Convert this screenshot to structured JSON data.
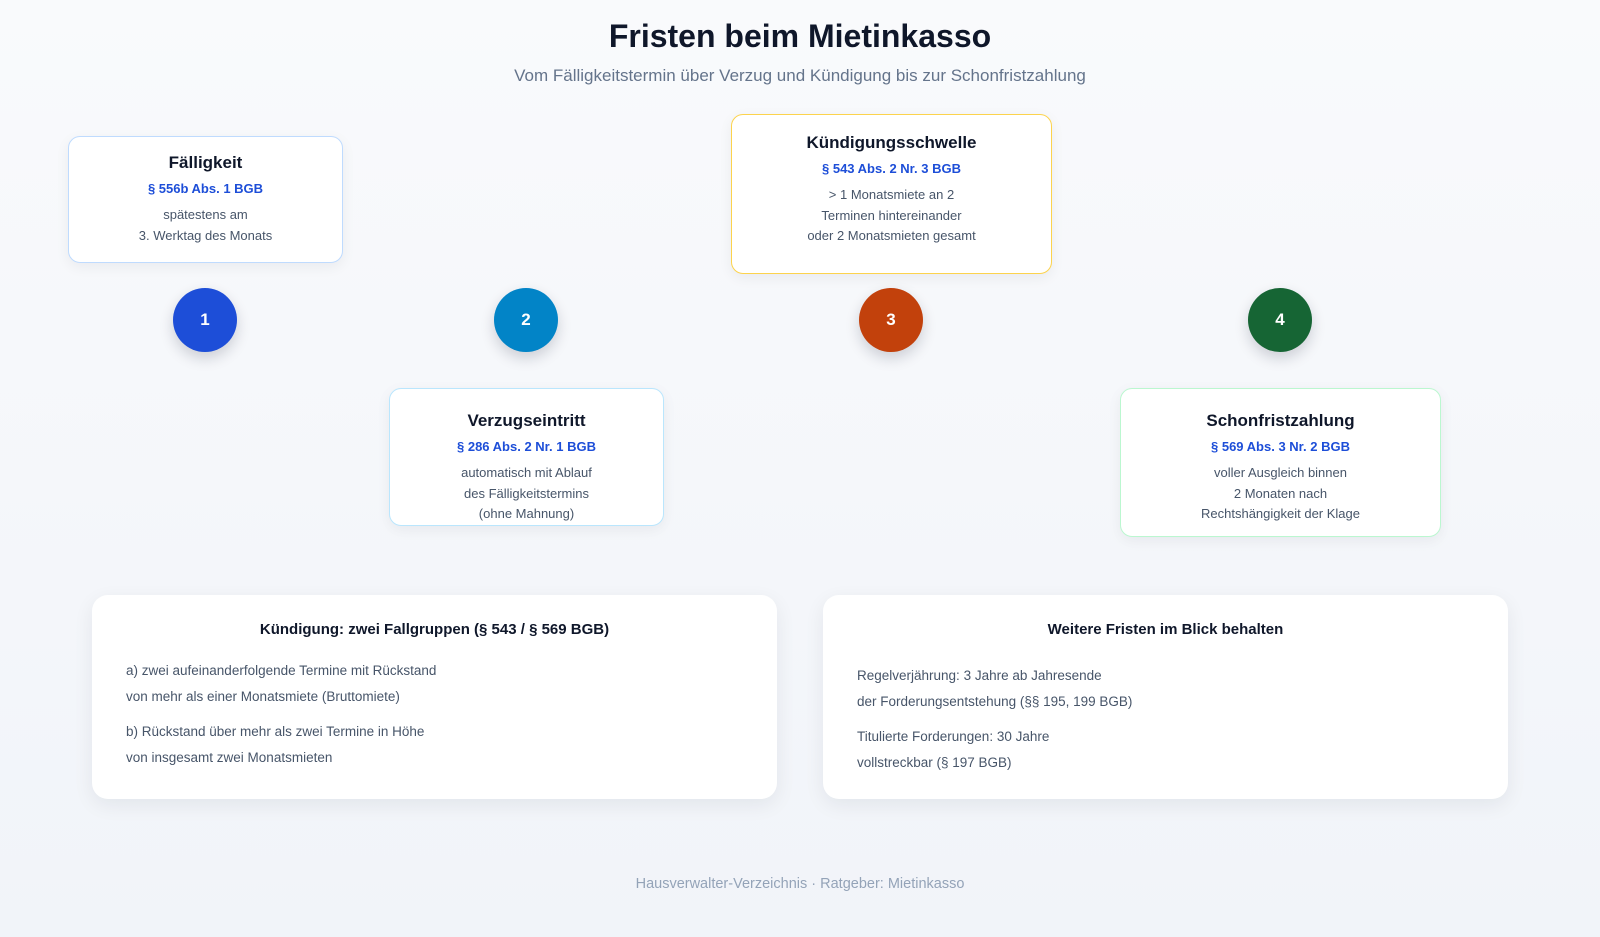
{
  "header": {
    "title": "Fristen beim Mietinkasso",
    "subtitle": "Vom Fälligkeitstermin über Verzug und Kündigung bis zur Schonfristzahlung"
  },
  "steps": [
    {
      "number": "1",
      "title": "Fälligkeit",
      "law": "§ 556b Abs. 1 BGB",
      "lines": [
        "spätestens am",
        "3. Werktag des Monats"
      ],
      "color": "#1d4ed8"
    },
    {
      "number": "2",
      "title": "Verzugseintritt",
      "law": "§ 286 Abs. 2 Nr. 1 BGB",
      "lines": [
        "automatisch mit Ablauf",
        "des Fälligkeitstermins",
        "(ohne Mahnung)"
      ],
      "color": "#0284c7"
    },
    {
      "number": "3",
      "title": "Kündigungsschwelle",
      "law": "§ 543 Abs. 2 Nr. 3 BGB",
      "lines": [
        "> 1 Monatsmiete an 2",
        "Terminen hintereinander",
        "oder 2 Monatsmieten gesamt"
      ],
      "color": "#c2410c"
    },
    {
      "number": "4",
      "title": "Schonfristzahlung",
      "law": "§ 569 Abs. 3 Nr. 2 BGB",
      "lines": [
        "voller Ausgleich binnen",
        "2 Monaten nach",
        "Rechtshängigkeit der Klage"
      ],
      "color": "#166534"
    }
  ],
  "info_boxes": [
    {
      "title": "Kündigung: zwei Fallgruppen (§ 543 / § 569 BGB)",
      "items": [
        [
          "a) zwei aufeinanderfolgende Termine mit Rückstand",
          "von mehr als einer Monatsmiete (Bruttomiete)"
        ],
        [
          "b) Rückstand über mehr als zwei Termine in Höhe",
          "von insgesamt zwei Monatsmieten"
        ]
      ]
    },
    {
      "title": "Weitere Fristen im Blick behalten",
      "items": [
        [
          "Regelverjährung: 3 Jahre ab Jahresende",
          "der Forderungsentstehung (§§ 195, 199 BGB)"
        ],
        [
          "Titulierte Forderungen: 30 Jahre",
          "vollstreckbar (§ 197 BGB)"
        ]
      ]
    }
  ],
  "footer": "Hausverwalter-Verzeichnis · Ratgeber: Mietinkasso"
}
